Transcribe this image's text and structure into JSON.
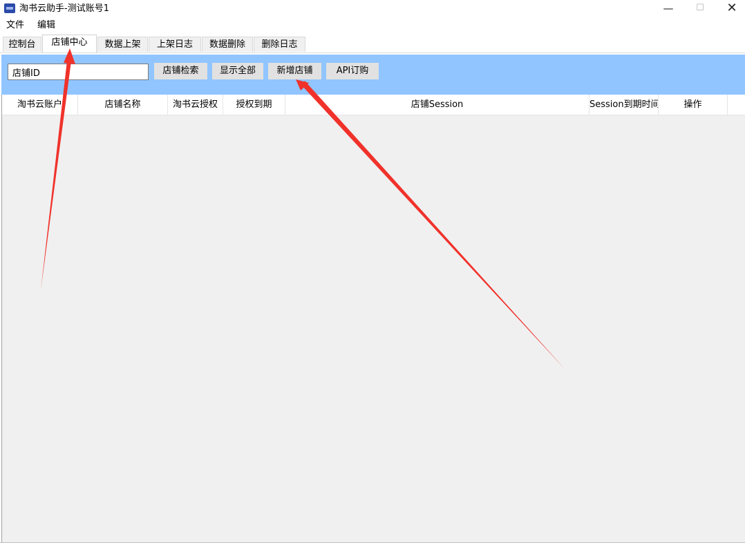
{
  "window": {
    "title": "淘书云助手-测试账号1",
    "minimize_glyph": "—",
    "maximize_glyph": "☐",
    "close_glyph": "✕"
  },
  "menu": {
    "file": "文件",
    "edit": "编辑"
  },
  "tabs": [
    {
      "label": "控制台"
    },
    {
      "label": "店铺中心",
      "active": true
    },
    {
      "label": "数据上架"
    },
    {
      "label": "上架日志"
    },
    {
      "label": "数据删除"
    },
    {
      "label": "删除日志"
    }
  ],
  "toolbar": {
    "search_value": "店铺ID",
    "search_button": "店铺检索",
    "show_all_button": "显示全部",
    "add_shop_button": "新增店铺",
    "api_subscribe_button": "API订购",
    "background_color": "#91c5ff"
  },
  "table": {
    "columns": [
      "淘书云账户",
      "店铺名称",
      "淘书云授权",
      "授权到期",
      "店铺Session",
      "Session到期时间",
      "操作"
    ],
    "rows": []
  },
  "annotations": {
    "arrow_color": "#f0322b"
  }
}
